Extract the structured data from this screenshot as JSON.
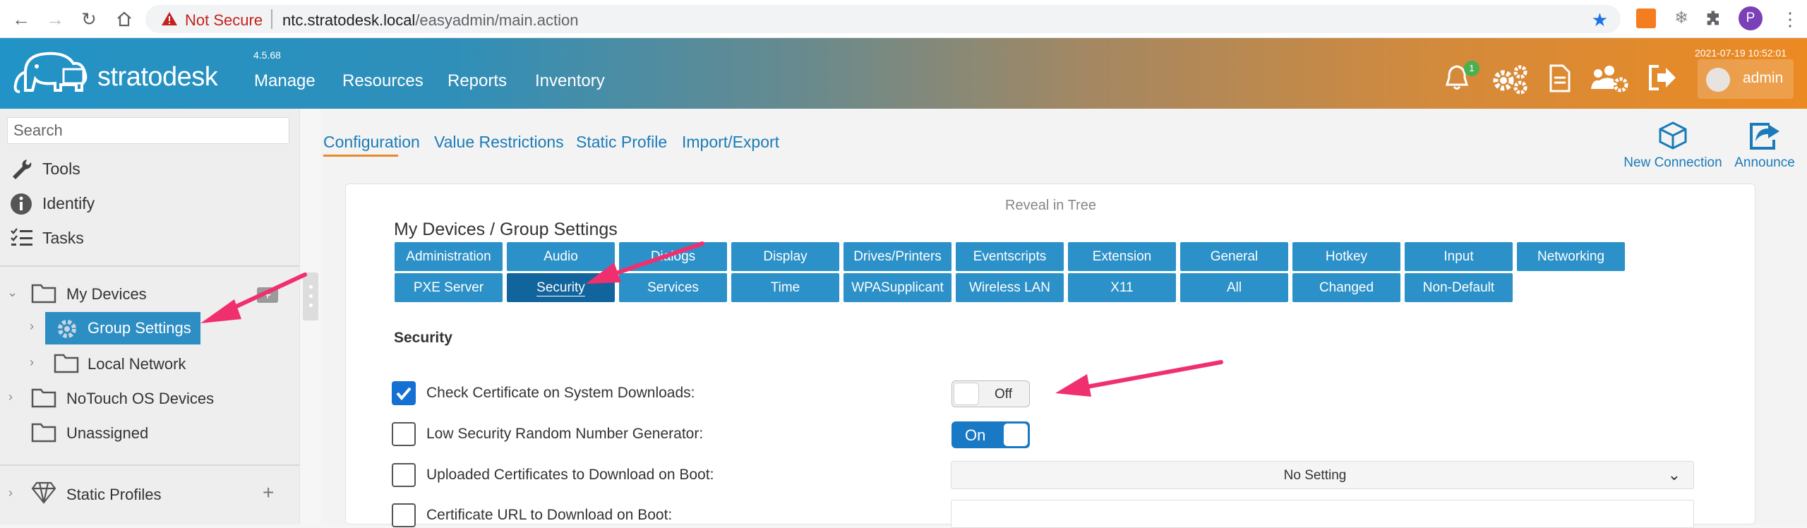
{
  "browser": {
    "not_secure": "Not Secure",
    "url_host": "ntc.stratodesk.local",
    "url_path": "/easyadmin/main.action",
    "profile_initial": "P"
  },
  "header": {
    "logo_text": "stratodesk",
    "version": "4.5.68",
    "nav": [
      "Manage",
      "Resources",
      "Reports",
      "Inventory"
    ],
    "datetime": "2021-07-19 10:52:01",
    "notification_count": "1",
    "user": "admin"
  },
  "sidebar": {
    "search_placeholder": "Search",
    "tools": [
      "Tools",
      "Identify",
      "Tasks"
    ],
    "tree": {
      "my_devices": "My Devices",
      "group_settings": "Group Settings",
      "local_network": "Local Network",
      "notouch": "NoTouch OS Devices",
      "unassigned": "Unassigned",
      "static_profiles": "Static Profiles"
    }
  },
  "main": {
    "subtabs": [
      "Configuration",
      "Value Restrictions",
      "Static Profile",
      "Import/Export"
    ],
    "actions": {
      "new_connection": "New Connection",
      "announce": "Announce"
    },
    "reveal": "Reveal in Tree",
    "breadcrumb": "My Devices / Group Settings",
    "categories_row1": [
      "Administration",
      "Audio",
      "Dialogs",
      "Display",
      "Drives/Printers",
      "Eventscripts",
      "Extension",
      "General",
      "Hotkey",
      "Input",
      "Networking"
    ],
    "categories_row2": [
      "PXE Server",
      "Security",
      "Services",
      "Time",
      "WPASupplicant",
      "Wireless LAN",
      "X11",
      "All",
      "Changed",
      "Non-Default"
    ],
    "active_category": "Security",
    "section_title": "Security",
    "settings": {
      "check_cert": {
        "label": "Check Certificate on System Downloads:",
        "checked": true,
        "toggle": "Off"
      },
      "low_security": {
        "label": "Low Security Random Number Generator:",
        "checked": false,
        "toggle": "On"
      },
      "uploaded_certs": {
        "label": "Uploaded Certificates to Download on Boot:",
        "checked": false,
        "value": "No Setting"
      },
      "cert_url": {
        "label": "Certificate URL to Download on Boot:",
        "checked": false
      }
    }
  },
  "colors": {
    "brand_blue": "#2c91c8",
    "active_blue": "#12649d",
    "accent_orange": "#e8892a",
    "annotation_pink": "#f0306e"
  }
}
